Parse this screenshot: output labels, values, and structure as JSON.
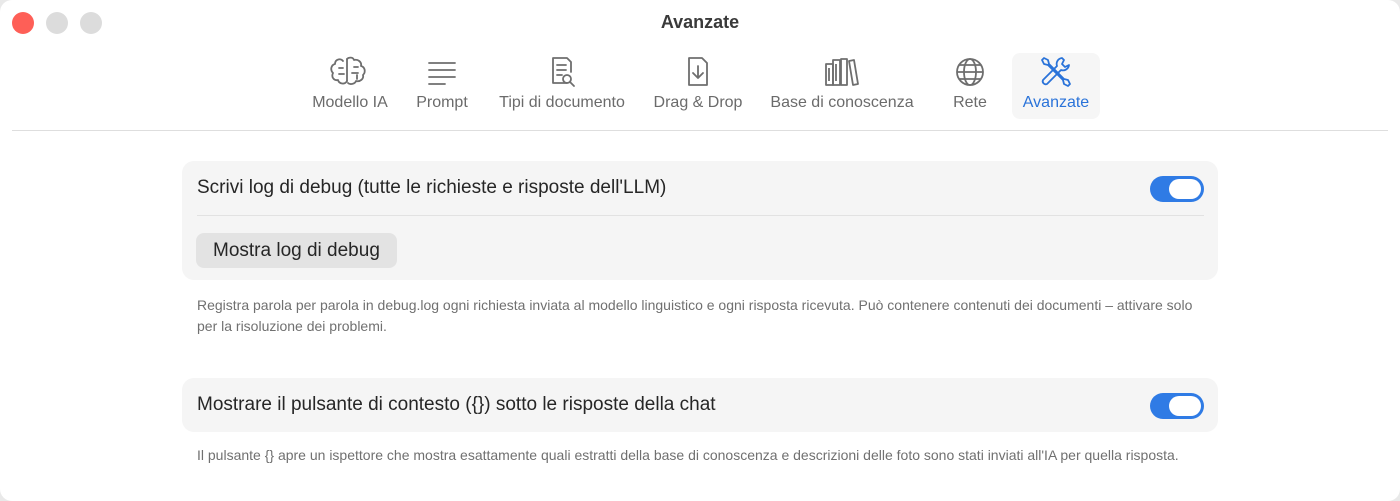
{
  "window": {
    "title": "Avanzate"
  },
  "toolbar": {
    "tabs": [
      {
        "label": "Modello IA",
        "icon": "brain-icon",
        "active": false
      },
      {
        "label": "Prompt",
        "icon": "text-lines-icon",
        "active": false
      },
      {
        "label": "Tipi di documento",
        "icon": "document-search-icon",
        "active": false
      },
      {
        "label": "Drag & Drop",
        "icon": "document-download-icon",
        "active": false
      },
      {
        "label": "Base di conoscenza",
        "icon": "books-icon",
        "active": false
      },
      {
        "label": "Rete",
        "icon": "globe-icon",
        "active": false
      },
      {
        "label": "Avanzate",
        "icon": "tools-icon",
        "active": true
      }
    ]
  },
  "settings": {
    "debug_log": {
      "label": "Scrivi log di debug (tutte le richieste e risposte dell'LLM)",
      "enabled": true,
      "button_label": "Mostra log di debug",
      "description": "Registra parola per parola in debug.log ogni richiesta inviata al modello linguistico e ogni risposta ricevuta. Può contenere contenuti dei documenti – attivare solo per la risoluzione dei problemi."
    },
    "context_button": {
      "label": "Mostrare il pulsante di contesto ({}) sotto le risposte della chat",
      "enabled": true,
      "description": "Il pulsante {} apre un ispettore che mostra esattamente quali estratti della base di conoscenza e descrizioni delle foto sono stati inviati all'IA per quella risposta."
    }
  },
  "colors": {
    "accent": "#2f7be5",
    "close": "#fe5f57"
  }
}
